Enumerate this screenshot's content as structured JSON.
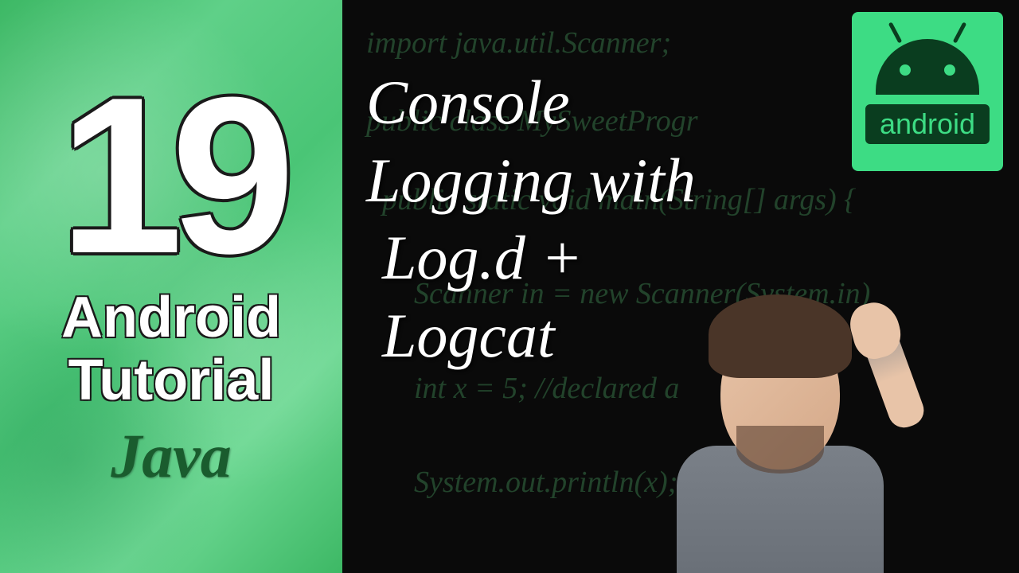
{
  "left": {
    "episode_number": "19",
    "subtitle_line1": "Android",
    "subtitle_line2": "Tutorial",
    "language": "Java"
  },
  "title": {
    "line1": "Console",
    "line2": "Logging with",
    "line3": "Log.d +",
    "line4": "Logcat"
  },
  "badge": {
    "label": "android"
  },
  "code_background": {
    "line1": "import java.util.Scanner;",
    "line2": "public class MySweetProgr",
    "line3": "public static void main(String[] args) {",
    "line4": "Scanner in = new Scanner(System.in)",
    "line5": "int x = 5; //declared a",
    "line6": "System.out.println(x);"
  }
}
